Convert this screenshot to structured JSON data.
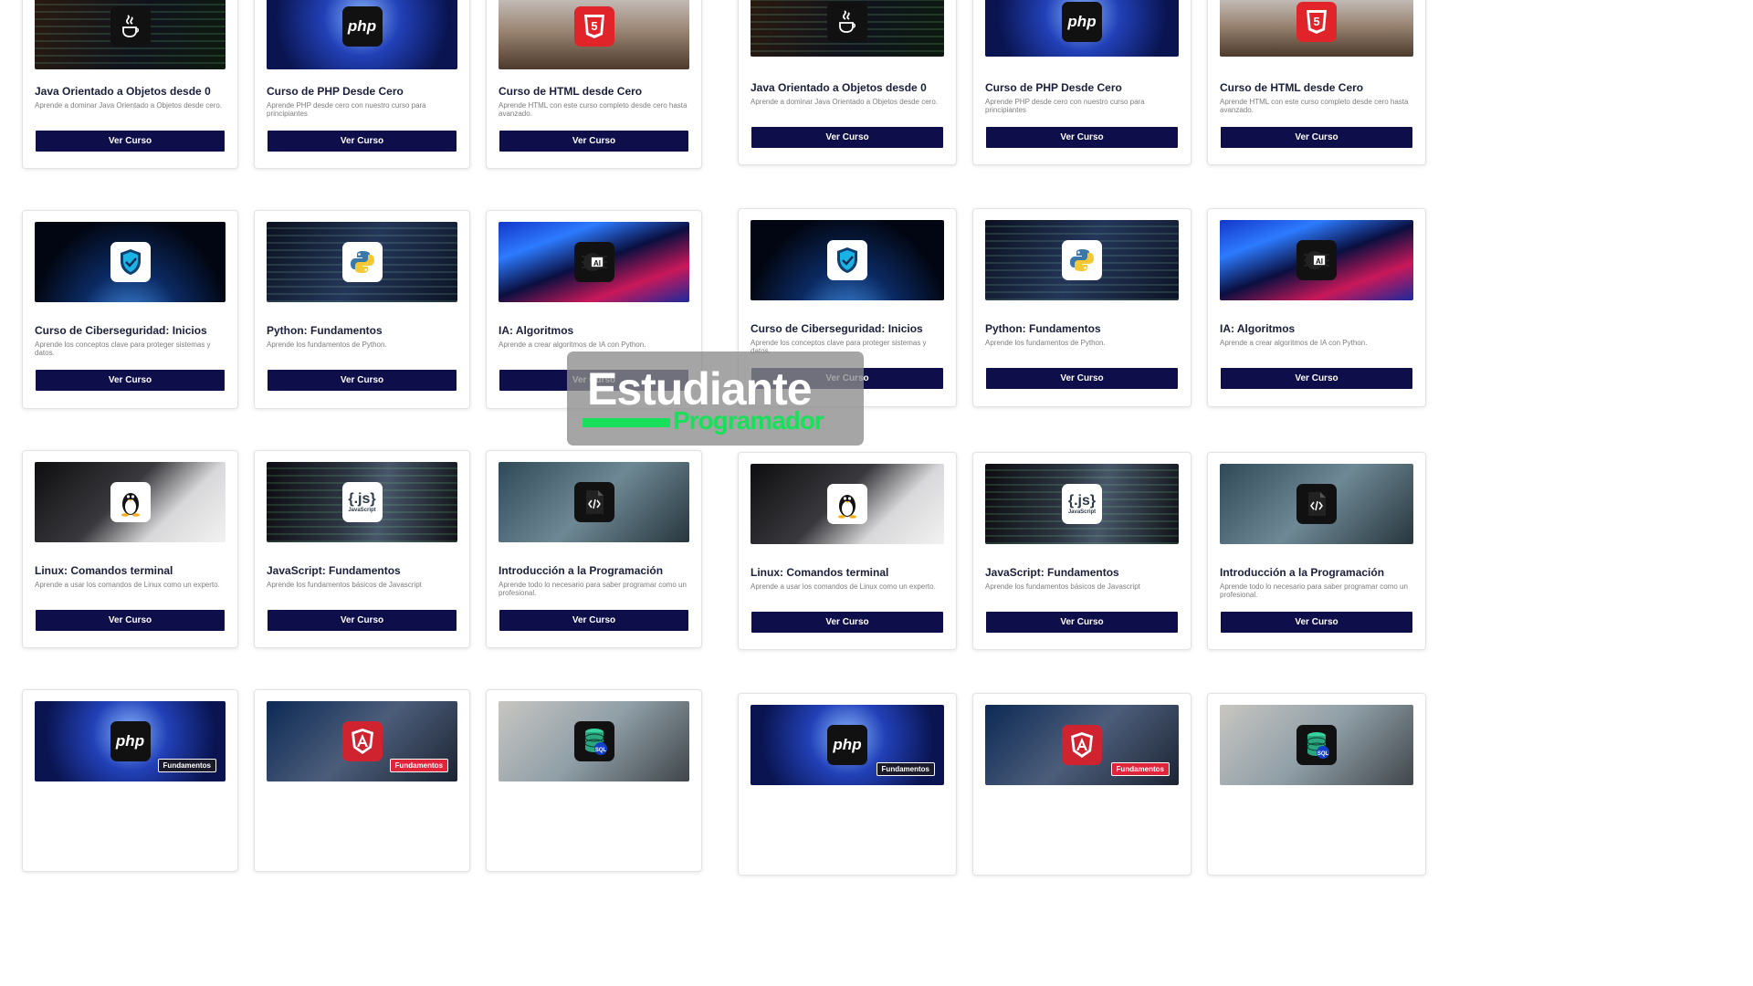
{
  "logo": {
    "main": "Estudiante",
    "sub": "Programador"
  },
  "ribbon_label": "Fundamentos",
  "button_label": "Ver Curso",
  "colors": {
    "button_bg": "#0e0e4a",
    "title": "#1b1f3b",
    "logo_green": "#19e05a"
  },
  "courses": [
    {
      "id": "java",
      "title": "Java Orientado a Objetos desde 0",
      "desc": "Aprende a dominar Java Orientado a Objetos desde cero.",
      "icon": "java-icon",
      "theme": "t-java",
      "ribbon": false
    },
    {
      "id": "php",
      "title": "Curso de PHP Desde Cero",
      "desc": "Aprende PHP desde cero con nuestro curso para principiantes",
      "icon": "php-icon",
      "theme": "t-php",
      "ribbon": false
    },
    {
      "id": "html",
      "title": "Curso de HTML desde Cero",
      "desc": "Aprende HTML con este curso completo desde cero hasta avanzado.",
      "icon": "html5-icon",
      "theme": "t-html",
      "ribbon": false
    },
    {
      "id": "cyber",
      "title": "Curso de Ciberseguridad: Inicios",
      "desc": "Aprende los conceptos clave para proteger sistemas y datos.",
      "icon": "shield-icon",
      "theme": "t-cyber",
      "ribbon": false
    },
    {
      "id": "python",
      "title": "Python: Fundamentos",
      "desc": "Aprende los fundamentos de Python.",
      "icon": "python-icon",
      "theme": "t-python",
      "ribbon": false
    },
    {
      "id": "ai",
      "title": "IA: Algoritmos",
      "desc": "Aprende a crear algoritmos de IA con Python.",
      "icon": "ai-chip-icon",
      "theme": "t-ai",
      "ribbon": false
    },
    {
      "id": "linux",
      "title": "Linux: Comandos terminal",
      "desc": "Aprende a usar los comandos de Linux como un experto.",
      "icon": "linux-penguin-icon",
      "theme": "t-linux",
      "ribbon": false
    },
    {
      "id": "js",
      "title": "JavaScript: Fundamentos",
      "desc": "Aprende los fundamentos básicos de Javascript",
      "icon": "javascript-icon",
      "theme": "t-js",
      "ribbon": false
    },
    {
      "id": "intro",
      "title": "Introducción a la Programación",
      "desc": "Aprende todo lo necesario para saber programar como un profesional.",
      "icon": "code-file-icon",
      "theme": "t-intro",
      "ribbon": false
    },
    {
      "id": "php2",
      "title": "",
      "desc": "",
      "icon": "php-icon",
      "theme": "t-php",
      "ribbon": true
    },
    {
      "id": "angular",
      "title": "",
      "desc": "",
      "icon": "angular-icon",
      "theme": "t-ang",
      "ribbon": true
    },
    {
      "id": "sql",
      "title": "",
      "desc": "",
      "icon": "sql-database-icon",
      "theme": "t-sql",
      "ribbon": false
    }
  ]
}
